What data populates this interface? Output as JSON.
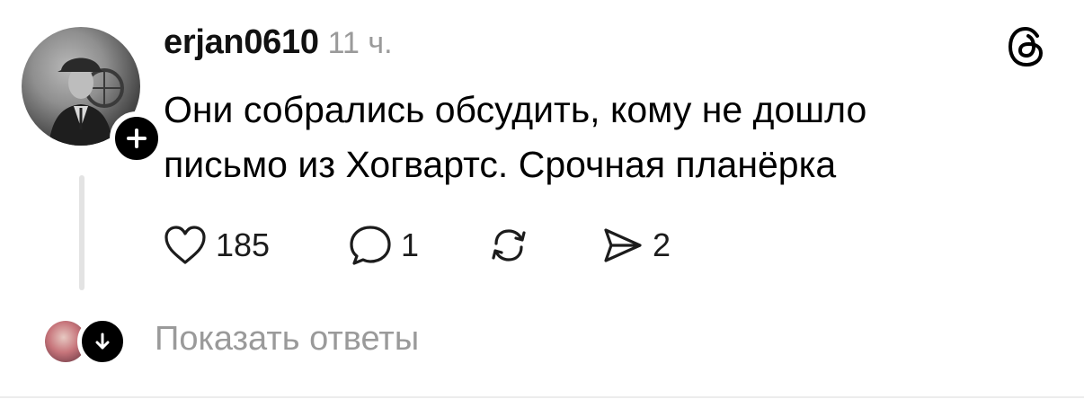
{
  "post": {
    "username": "erjan0610",
    "time": "11 ч.",
    "text_line_1": "Они собрались обсудить, кому не дошло",
    "text_line_2": "письмо из Хогвартс. Срочная планёрка"
  },
  "actions": {
    "likes": "185",
    "comments": "1",
    "shares": "2"
  },
  "replies": {
    "label": "Показать ответы"
  },
  "icons": {
    "app": "threads-logo-icon",
    "like": "heart-icon",
    "comment": "speech-bubble-icon",
    "repost": "repost-icon",
    "share": "send-icon"
  }
}
